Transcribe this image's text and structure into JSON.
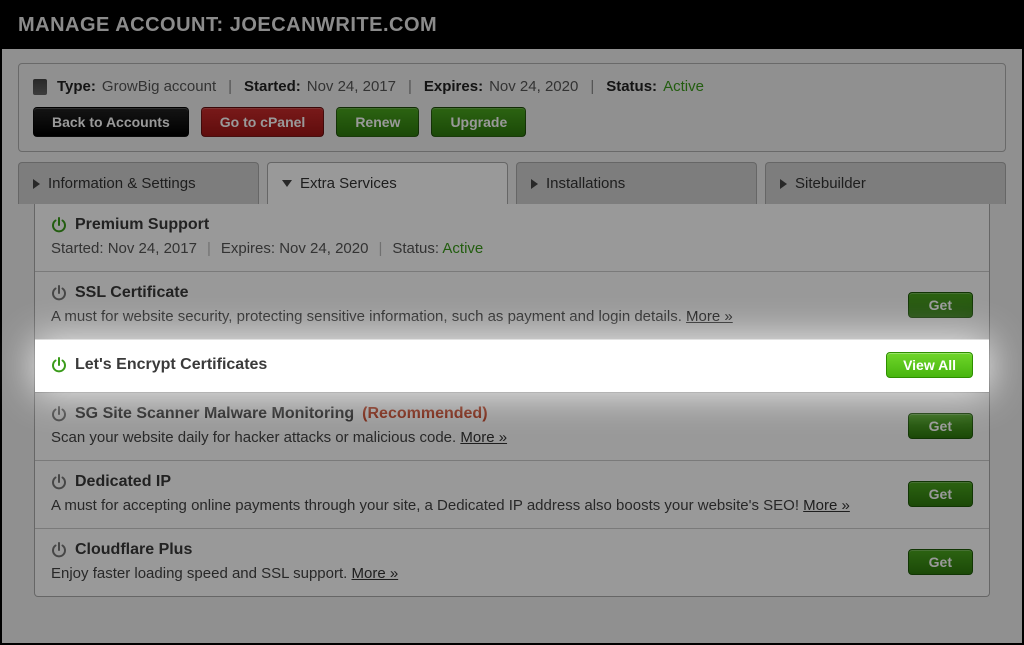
{
  "header": {
    "title": "MANAGE ACCOUNT: JOECANWRITE.COM"
  },
  "account": {
    "type_label": "Type:",
    "type_value": "GrowBig account",
    "started_label": "Started:",
    "started_value": "Nov 24, 2017",
    "expires_label": "Expires:",
    "expires_value": "Nov 24, 2020",
    "status_label": "Status:",
    "status_value": "Active"
  },
  "buttons": {
    "back": "Back to Accounts",
    "cpanel": "Go to cPanel",
    "renew": "Renew",
    "upgrade": "Upgrade"
  },
  "tabs": {
    "info": "Information & Settings",
    "extra": "Extra Services",
    "installs": "Installations",
    "sitebuilder": "Sitebuilder"
  },
  "services": {
    "premium": {
      "title": "Premium Support",
      "started_label": "Started:",
      "started_value": "Nov 24, 2017",
      "expires_label": "Expires:",
      "expires_value": "Nov 24, 2020",
      "status_label": "Status:",
      "status_value": "Active"
    },
    "ssl": {
      "title": "SSL Certificate",
      "desc": "A must for website security, protecting sensitive information, such as payment and login details.",
      "more": "More »",
      "action": "Get"
    },
    "letsencrypt": {
      "title": "Let's Encrypt Certificates",
      "action": "View All"
    },
    "scanner": {
      "title": "SG Site Scanner Malware Monitoring",
      "recommended": "(Recommended)",
      "desc": "Scan your website daily for hacker attacks or malicious code.",
      "more": "More »",
      "action": "Get"
    },
    "dedicated_ip": {
      "title": "Dedicated IP",
      "desc": "A must for accepting online payments through your site, a Dedicated IP address also boosts your website's SEO!",
      "more": "More »",
      "action": "Get"
    },
    "cloudflare": {
      "title": "Cloudflare Plus",
      "desc": "Enjoy faster loading speed and SSL support.",
      "more": "More »",
      "action": "Get"
    }
  },
  "colors": {
    "active_green": "#3a9b1a",
    "recommended_red": "#c23a1a"
  }
}
